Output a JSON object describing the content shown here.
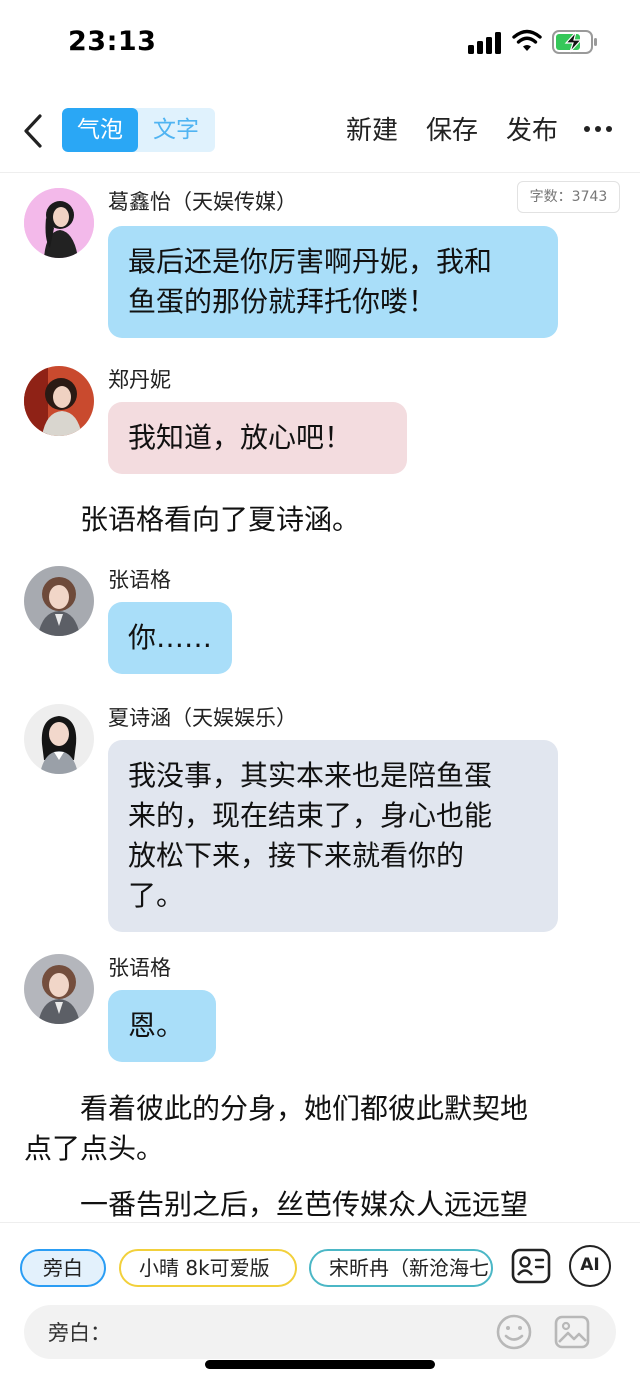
{
  "status_bar": {
    "time": "23:13"
  },
  "nav": {
    "tabs": [
      {
        "label": "气泡",
        "active": true
      },
      {
        "label": "文字",
        "active": false
      }
    ],
    "actions": {
      "new": "新建",
      "save": "保存",
      "publish": "发布"
    }
  },
  "word_count": "字数：3743",
  "chat": [
    {
      "type": "message",
      "speaker": "葛鑫怡（天娱传媒）",
      "color": "blue",
      "lines": [
        "最后还是你厉害啊丹妮，我和",
        "鱼蛋的那份就拜托你喽！"
      ]
    },
    {
      "type": "message",
      "speaker": "郑丹妮",
      "color": "pink",
      "lines": [
        "我知道，放心吧！"
      ]
    },
    {
      "type": "narration",
      "lines": [
        "　　张语格看向了夏诗涵。"
      ]
    },
    {
      "type": "message",
      "speaker": "张语格",
      "color": "blue",
      "lines": [
        "你……"
      ]
    },
    {
      "type": "message",
      "speaker": "夏诗涵（天娱娱乐）",
      "color": "grey",
      "lines": [
        "我没事，其实本来也是陪鱼蛋",
        "来的，现在结束了，身心也能",
        "放松下来，接下来就看你的",
        "了。"
      ]
    },
    {
      "type": "message",
      "speaker": "张语格",
      "color": "blue",
      "lines": [
        "恩。"
      ]
    },
    {
      "type": "narration",
      "lines": [
        "　　看着彼此的分身，她们都彼此默契地",
        "点了点头。"
      ]
    },
    {
      "type": "narration",
      "lines": [
        "　　一番告别之后，丝芭传媒众人远远望"
      ]
    }
  ],
  "characters": [
    {
      "label": "旁白",
      "selected": true
    },
    {
      "label": "小晴 8k可爱版"
    },
    {
      "label": "宋昕冉（新沧海七"
    }
  ],
  "ai_button": "AI",
  "input": {
    "label": "旁白："
  },
  "colors": {
    "accent": "#2aa7f5",
    "bubble_blue": "#a9def9",
    "bubble_pink": "#f3dcdf",
    "bubble_grey": "#e1e6ef"
  }
}
